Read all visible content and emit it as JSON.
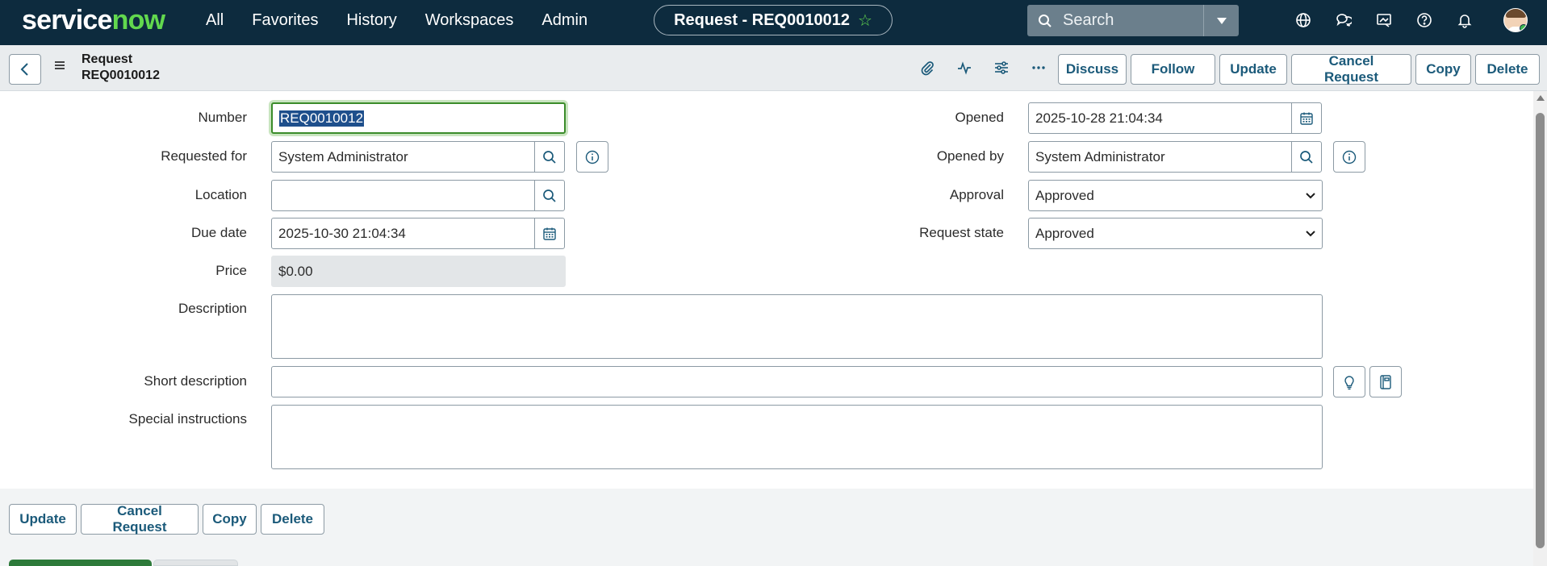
{
  "nav": {
    "logo": "servicenow",
    "links": [
      "All",
      "Favorites",
      "History",
      "Workspaces",
      "Admin"
    ],
    "record_pill": "Request - REQ0010012",
    "search_placeholder": "Search"
  },
  "header": {
    "title_line1": "Request",
    "title_line2": "REQ0010012",
    "buttons": [
      "Discuss",
      "Follow",
      "Update",
      "Cancel Request",
      "Copy",
      "Delete"
    ]
  },
  "form": {
    "number": {
      "label": "Number",
      "value": "REQ0010012"
    },
    "requested_for": {
      "label": "Requested for",
      "value": "System Administrator"
    },
    "location": {
      "label": "Location",
      "value": ""
    },
    "due_date": {
      "label": "Due date",
      "value": "2025-10-30 21:04:34"
    },
    "price": {
      "label": "Price",
      "value": "$0.00"
    },
    "opened": {
      "label": "Opened",
      "value": "2025-10-28 21:04:34"
    },
    "opened_by": {
      "label": "Opened by",
      "value": "System Administrator"
    },
    "approval": {
      "label": "Approval",
      "value": "Approved"
    },
    "request_state": {
      "label": "Request state",
      "value": "Approved"
    },
    "description": {
      "label": "Description",
      "value": ""
    },
    "short_description": {
      "label": "Short description",
      "value": ""
    },
    "special_instructions": {
      "label": "Special instructions",
      "value": ""
    }
  },
  "footer": {
    "buttons": [
      "Update",
      "Cancel Request",
      "Copy",
      "Delete"
    ]
  },
  "colors": {
    "nav_bg": "#0d2b3e",
    "accent_green": "#62d84e",
    "button_text": "#1b5a7a",
    "focus_border": "#3b8c2a",
    "selection_bg": "#1e4f8c"
  }
}
